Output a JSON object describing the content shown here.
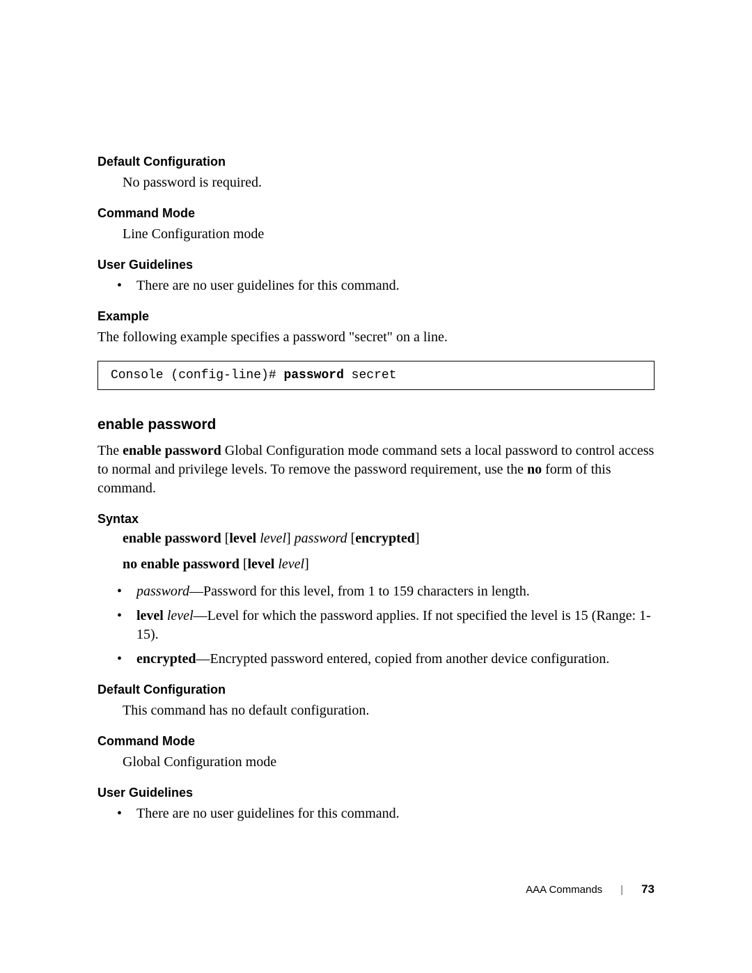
{
  "sections": {
    "default_cfg_1": {
      "heading": "Default Configuration",
      "body": "No password is required."
    },
    "cmd_mode_1": {
      "heading": "Command Mode",
      "body": "Line Configuration mode"
    },
    "user_guide_1": {
      "heading": "User Guidelines",
      "bullet": "There are no user guidelines for this command."
    },
    "example": {
      "heading": "Example",
      "intro": "The following example specifies a password \"secret\" on a line.",
      "code_prefix": "Console (config-line)# ",
      "code_cmd": "password",
      "code_suffix": " secret"
    },
    "enable_pw": {
      "heading": "enable password",
      "para_pre": "The ",
      "para_cmd": "enable password",
      "para_mid": " Global Configuration mode command sets a local password to control access to normal and privilege levels. To remove the password requirement, use the ",
      "para_no": "no",
      "para_post": " form of this command."
    },
    "syntax": {
      "heading": "Syntax",
      "line1": {
        "t1": "enable password ",
        "br1": "[",
        "t2": "level ",
        "i1": "level",
        "br2": "] ",
        "i2": "password ",
        "br3": "[",
        "t3": "encrypted",
        "br4": "]"
      },
      "line2": {
        "t1": "no enable password ",
        "br1": "[",
        "t2": "level ",
        "i1": "level",
        "br2": "]"
      },
      "bullets": {
        "b1": {
          "lead_i": "password",
          "dash": "—",
          "rest": "Password for this level, from 1 to 159 characters in length."
        },
        "b2": {
          "lead_b": "level ",
          "lead_i": "level",
          "dash": "—",
          "rest": "Level for which the password applies. If not specified the level is 15 (Range: 1-15)."
        },
        "b3": {
          "lead_b": "encrypted",
          "dash": "—",
          "rest": "Encrypted password entered, copied from another device configuration."
        }
      }
    },
    "default_cfg_2": {
      "heading": "Default Configuration",
      "body": "This command has no default configuration."
    },
    "cmd_mode_2": {
      "heading": "Command Mode",
      "body": "Global Configuration mode"
    },
    "user_guide_2": {
      "heading": "User Guidelines",
      "bullet": "There are no user guidelines for this command."
    }
  },
  "footer": {
    "label": "AAA Commands",
    "sep": "|",
    "page": "73"
  }
}
